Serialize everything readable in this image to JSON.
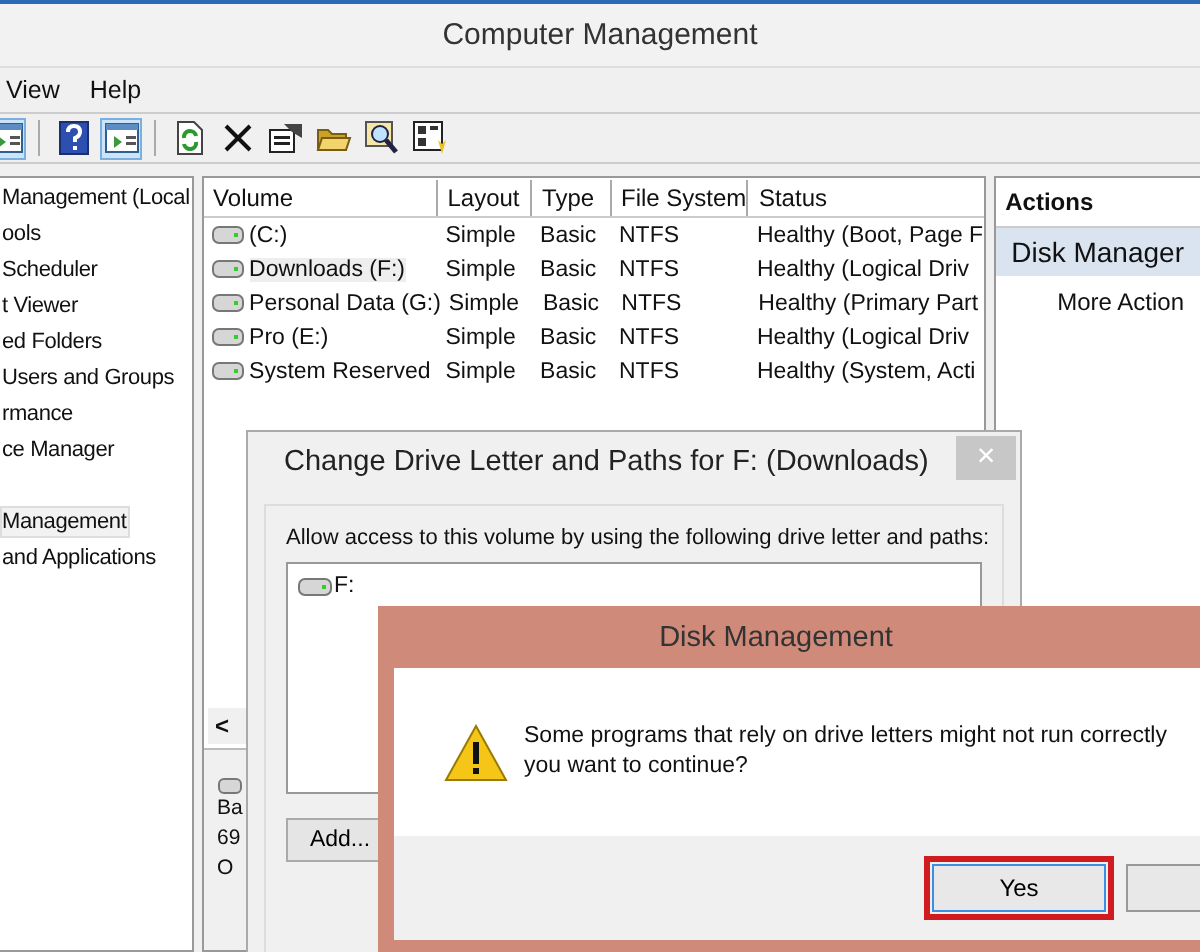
{
  "window": {
    "title": "Computer Management"
  },
  "menu": [
    "View",
    "Help"
  ],
  "toolbar": [
    {
      "selected": true
    },
    {
      "selected": false
    },
    {
      "selected": true
    },
    {
      "selected": false
    },
    {
      "selected": false
    },
    {
      "selected": false
    },
    {
      "selected": false
    },
    {
      "selected": false
    },
    {
      "selected": false
    }
  ],
  "tree": [
    {
      "label": "Management (Local",
      "selected": false
    },
    {
      "label": "ools",
      "selected": false
    },
    {
      "label": "Scheduler",
      "selected": false
    },
    {
      "label": "t Viewer",
      "selected": false
    },
    {
      "label": "ed Folders",
      "selected": false
    },
    {
      "label": "Users and Groups",
      "selected": false
    },
    {
      "label": "rmance",
      "selected": false
    },
    {
      "label": "ce Manager",
      "selected": false
    },
    {
      "label": "Management",
      "selected": true
    },
    {
      "label": "and Applications",
      "selected": false
    }
  ],
  "table": {
    "columns": [
      "Volume",
      "Layout",
      "Type",
      "File System",
      "Status"
    ],
    "rows": [
      {
        "cells": [
          "(C:)",
          "Simple",
          "Basic",
          "NTFS",
          "Healthy (Boot, Page F"
        ],
        "selected": false
      },
      {
        "cells": [
          "Downloads (F:)",
          "Simple",
          "Basic",
          "NTFS",
          "Healthy (Logical Driv"
        ],
        "selected": true
      },
      {
        "cells": [
          "Personal Data (G:)",
          "Simple",
          "Basic",
          "NTFS",
          "Healthy (Primary Part"
        ],
        "selected": false
      },
      {
        "cells": [
          "Pro (E:)",
          "Simple",
          "Basic",
          "NTFS",
          "Healthy (Logical Driv"
        ],
        "selected": false
      },
      {
        "cells": [
          "System Reserved",
          "Simple",
          "Basic",
          "NTFS",
          "Healthy (System, Acti"
        ],
        "selected": false
      }
    ]
  },
  "scroll_arrow": "<",
  "lower_pane": [
    "Ba",
    "69",
    "O"
  ],
  "actions": {
    "title": "Actions",
    "items": [
      {
        "label": "Disk Manager",
        "kind": "group"
      },
      {
        "label": "More Action",
        "kind": "link"
      }
    ]
  },
  "drive_dialog": {
    "title": "Change Drive Letter and Paths for F: (Downloads)",
    "close": "×",
    "instruction": "Allow access to this volume by using the following drive letter and paths:",
    "paths": [
      "F:"
    ],
    "buttons": [
      "Add..."
    ]
  },
  "confirm_dialog": {
    "title": "Disk Management",
    "message": [
      "Some programs that rely on drive letters might not run correctly",
      "you want to continue?"
    ],
    "buttons": [
      {
        "label": "Yes",
        "highlighted": true
      }
    ]
  }
}
